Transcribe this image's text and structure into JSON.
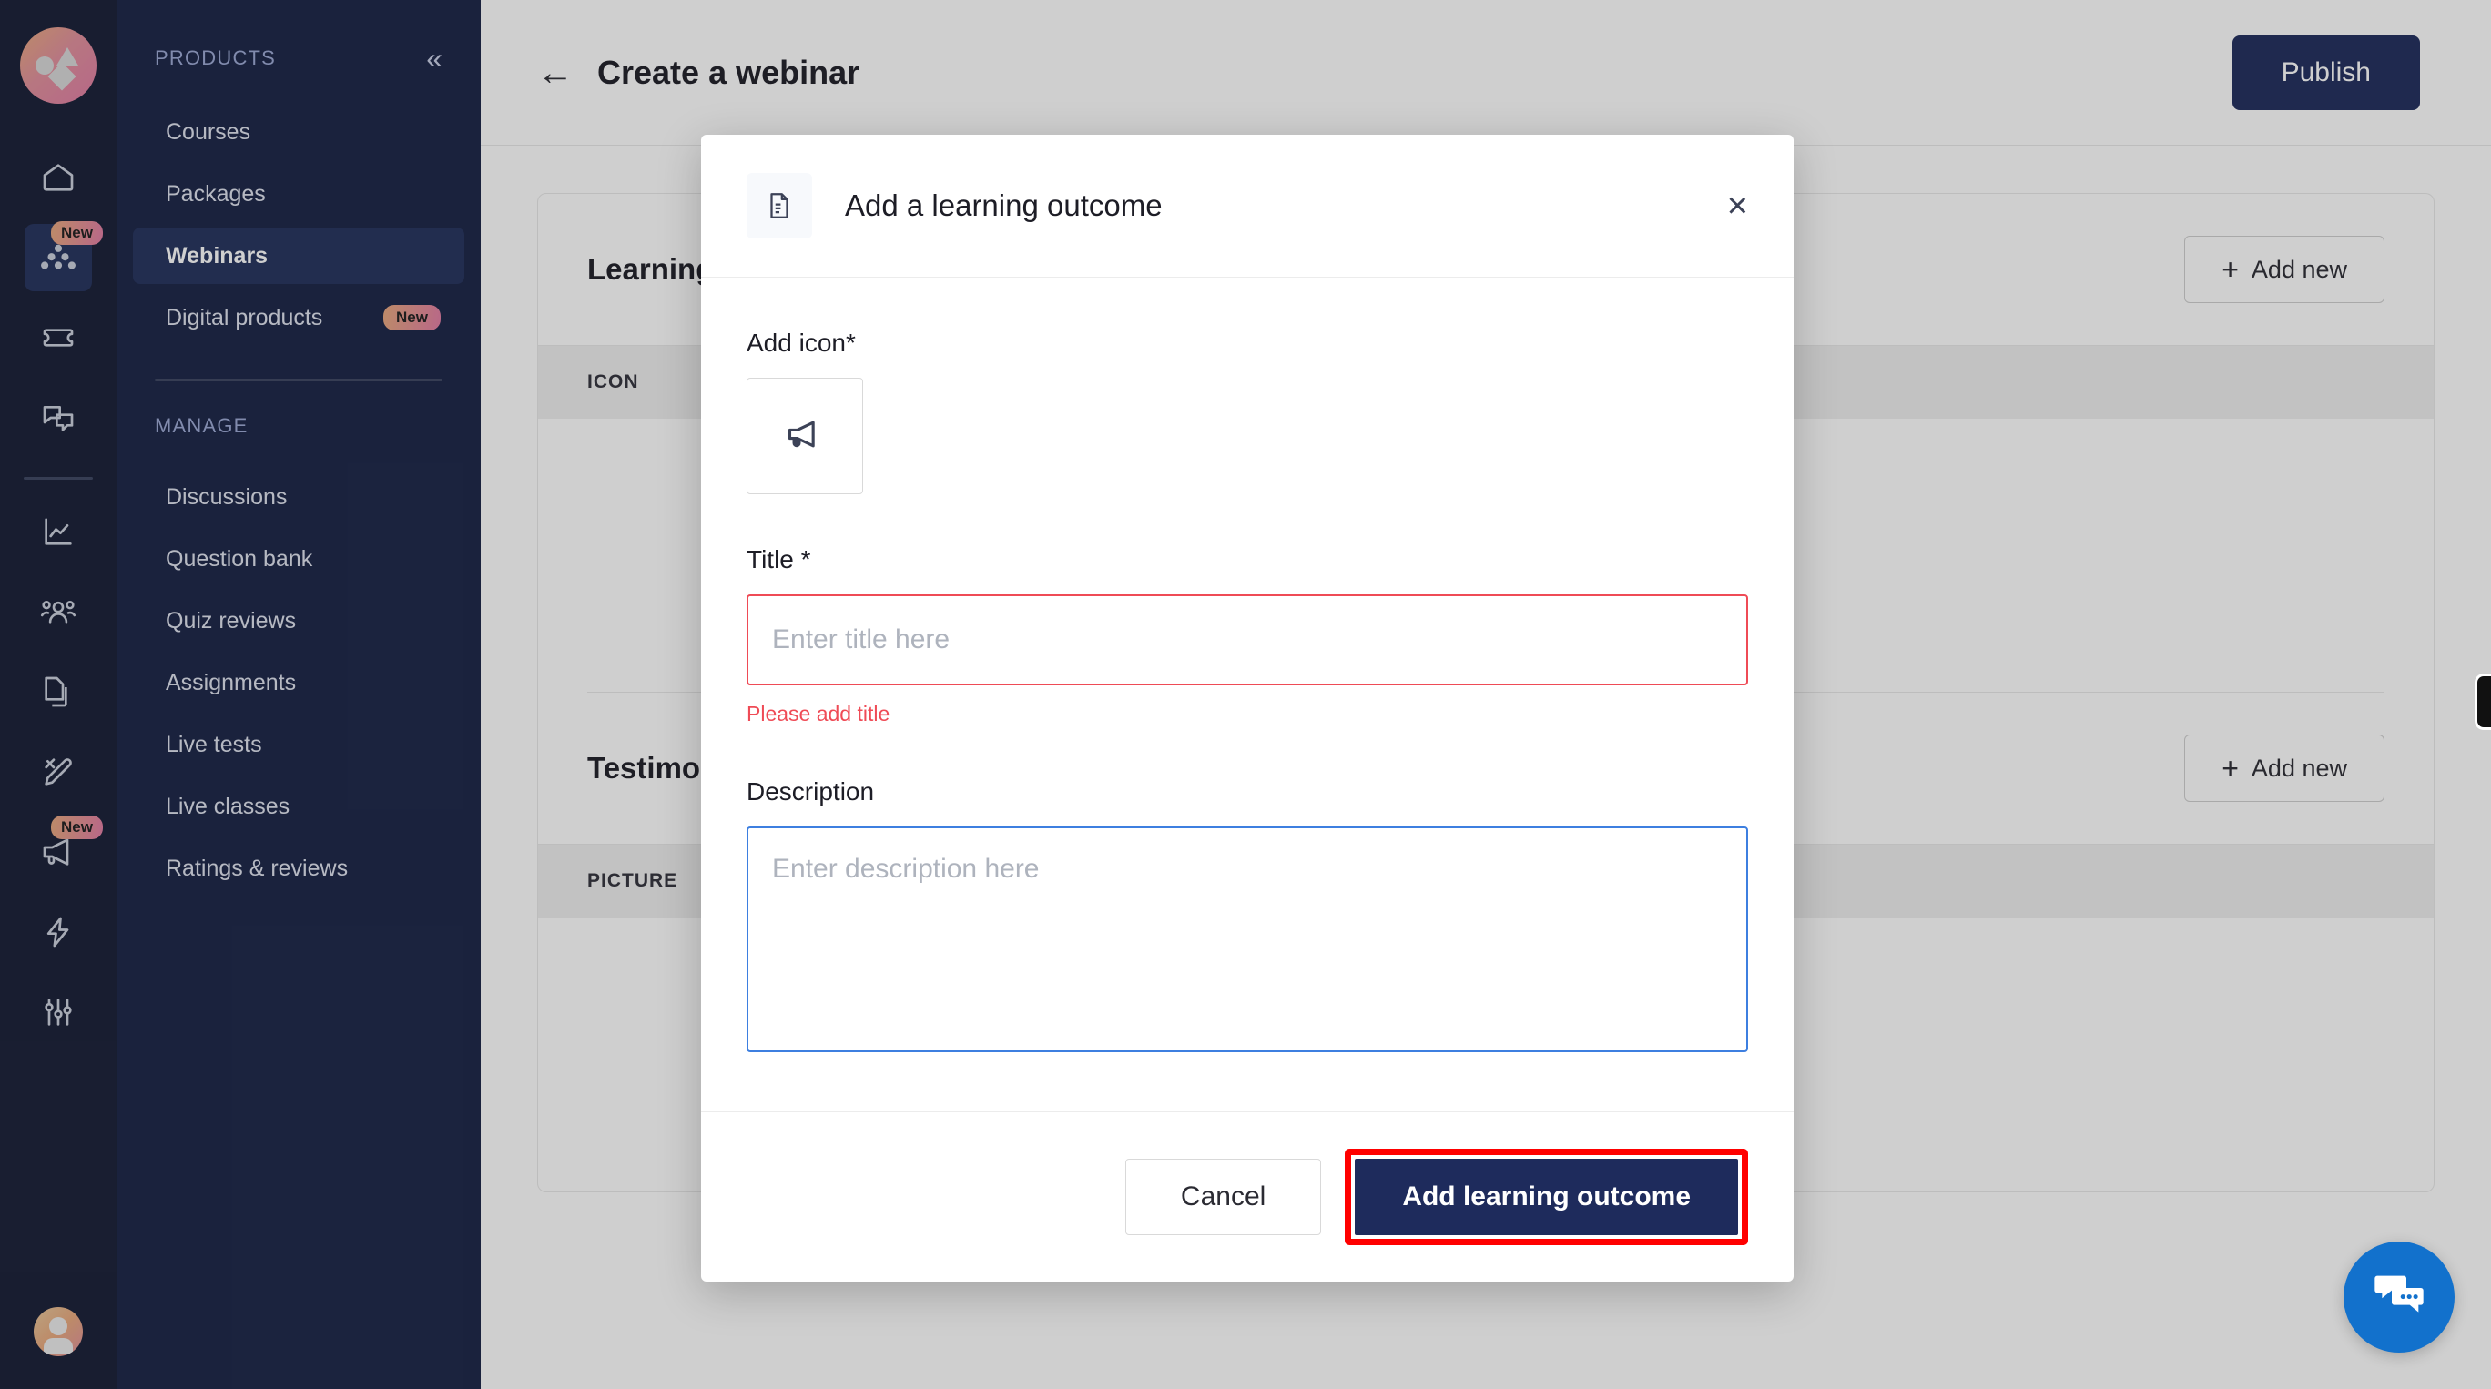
{
  "rail": {
    "logo_name": "brand-logo",
    "items": [
      {
        "icon": "home-icon",
        "active": false,
        "badge": ""
      },
      {
        "icon": "products-icon",
        "active": true,
        "badge": "New"
      },
      {
        "icon": "ticket-icon",
        "active": false,
        "badge": ""
      },
      {
        "icon": "chat-icon",
        "active": false,
        "badge": ""
      },
      {
        "icon": "analytics-icon",
        "active": false,
        "badge": ""
      },
      {
        "icon": "users-icon",
        "active": false,
        "badge": ""
      },
      {
        "icon": "pages-icon",
        "active": false,
        "badge": ""
      },
      {
        "icon": "design-icon",
        "active": false,
        "badge": ""
      },
      {
        "icon": "megaphone-icon",
        "active": false,
        "badge": "New"
      },
      {
        "icon": "bolt-icon",
        "active": false,
        "badge": ""
      },
      {
        "icon": "settings-sliders-icon",
        "active": false,
        "badge": ""
      }
    ]
  },
  "sidebar": {
    "products_label": "PRODUCTS",
    "collapse_icon": "«",
    "products": [
      {
        "label": "Courses",
        "badge": ""
      },
      {
        "label": "Packages",
        "badge": ""
      },
      {
        "label": "Webinars",
        "badge": ""
      },
      {
        "label": "Digital products",
        "badge": "New"
      }
    ],
    "manage_label": "MANAGE",
    "manage": [
      {
        "label": "Discussions"
      },
      {
        "label": "Question bank"
      },
      {
        "label": "Quiz reviews"
      },
      {
        "label": "Assignments"
      },
      {
        "label": "Live tests"
      },
      {
        "label": "Live classes"
      },
      {
        "label": "Ratings & reviews"
      }
    ]
  },
  "topbar": {
    "back_icon": "←",
    "title": "Create a webinar",
    "publish_label": "Publish"
  },
  "page": {
    "sections": [
      {
        "title": "Learning outcomes",
        "add_label": "Add new",
        "plus": "+",
        "column_header": "ICON"
      },
      {
        "title": "Testimonials",
        "add_label": "Add new",
        "plus": "+",
        "column_header": "PICTURE"
      }
    ]
  },
  "modal": {
    "header_icon": "document-icon",
    "title": "Add a learning outcome",
    "close_icon": "×",
    "icon_field": {
      "label": "Add icon*",
      "selected_icon": "megaphone-icon"
    },
    "title_field": {
      "label": "Title *",
      "value": "",
      "placeholder": "Enter title here",
      "error": "Please add title"
    },
    "description_field": {
      "label": "Description",
      "value": "",
      "placeholder": "Enter description here"
    },
    "cancel_label": "Cancel",
    "submit_label": "Add learning outcome"
  },
  "chat_widget": {
    "icon": "chat-bubbles-icon"
  },
  "colors": {
    "rail_bg": "#151c34",
    "sidebar_bg": "#182245",
    "active_nav": "#22305c",
    "primary": "#1e2b5c",
    "error": "#ef4b56",
    "focus_border": "#3d7fe0",
    "highlight": "#ff0000",
    "chat_blue": "#1271cc"
  }
}
